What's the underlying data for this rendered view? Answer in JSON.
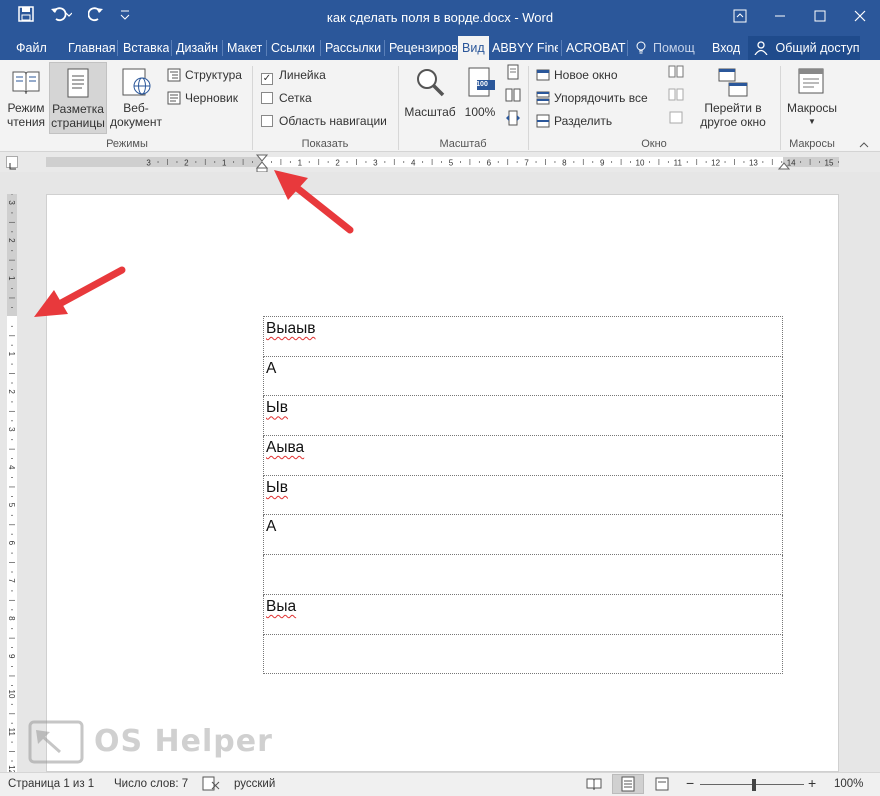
{
  "titlebar": {
    "title": "как сделать поля в ворде.docx - Word",
    "qat": {
      "save_icon": "save-icon",
      "undo_icon": "undo-icon",
      "redo_icon": "redo-icon",
      "customize_icon": "customize-qat-icon"
    },
    "controls": {
      "ribbon_options": "ribbon-display-options-icon",
      "minimize": "minimize-icon",
      "maximize": "maximize-icon",
      "close": "close-icon"
    }
  },
  "tabs": {
    "file": "Файл",
    "home": "Главная",
    "insert": "Вставка",
    "design": "Дизайн",
    "layout": "Макет",
    "references": "Ссылки",
    "mailings": "Рассылки",
    "review": "Рецензиров",
    "view": "Вид",
    "abbyy": "ABBYY Finel",
    "acrobat": "ACROBAT",
    "tellme": "Помощ",
    "signin": "Вход",
    "share": "Общий доступ"
  },
  "ribbon": {
    "views": {
      "group_name": "Режимы",
      "read_mode": [
        "Режим",
        "чтения"
      ],
      "print_layout": [
        "Разметка",
        "страницы"
      ],
      "web_layout": [
        "Веб-",
        "документ"
      ],
      "outline": "Структура",
      "draft": "Черновик"
    },
    "show": {
      "group_name": "Показать",
      "ruler": "Линейка",
      "ruler_checked": true,
      "gridlines": "Сетка",
      "navigation_pane": "Область навигации"
    },
    "zoom": {
      "group_name": "Масштаб",
      "zoom": "Масштаб",
      "hundred": "100%",
      "hundred_badge": "100"
    },
    "window": {
      "group_name": "Окно",
      "new_window": "Новое окно",
      "arrange_all": "Упорядочить все",
      "split": "Разделить",
      "switch_windows": [
        "Перейти в",
        "другое окно"
      ]
    },
    "macros": {
      "group_name": "Макросы",
      "macros": "Макросы"
    }
  },
  "ruler": {
    "h_labels": [
      "3",
      "2",
      "1",
      "1",
      "2",
      "3",
      "4",
      "5",
      "6",
      "7",
      "8",
      "9",
      "10",
      "11",
      "12",
      "13",
      "14",
      "15"
    ],
    "v_labels": [
      "3",
      "2",
      "1",
      "1",
      "2",
      "3",
      "4",
      "5",
      "6",
      "7",
      "8",
      "9",
      "10",
      "11",
      "12"
    ]
  },
  "document": {
    "table_rows": [
      "Выаыв",
      "А",
      "Ыв",
      "Аыва",
      "Ыв",
      "А",
      "",
      "Выа",
      ""
    ],
    "misspelled_rows": [
      0,
      2,
      3,
      4,
      7
    ]
  },
  "watermark": {
    "text": "OS Helper"
  },
  "statusbar": {
    "page": "Страница 1 из 1",
    "words": "Число слов: 7",
    "language": "русский",
    "zoom": "100%",
    "zoom_minus": "−",
    "zoom_plus": "+"
  },
  "colors": {
    "titlebar": "#2b579a",
    "ribbon_bg": "#f3f3f3",
    "annotation_arrow": "#e8393c",
    "spell_underline": "#e03030"
  }
}
